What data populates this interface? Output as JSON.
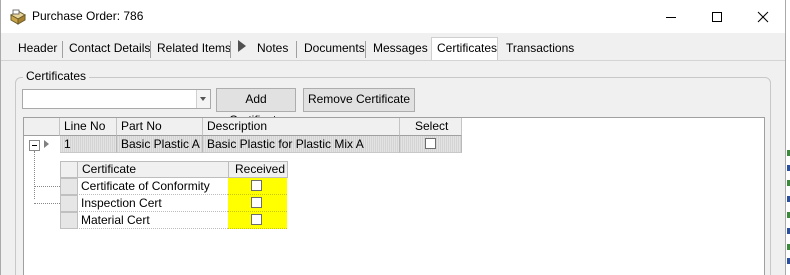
{
  "window": {
    "title": "Purchase Order: 786",
    "controls": {
      "minimize": "minimize",
      "maximize": "maximize",
      "close": "close"
    }
  },
  "tabs": [
    {
      "label": "Header"
    },
    {
      "label": "Contact Details"
    },
    {
      "label": "Related Items"
    },
    {
      "label": "Notes"
    },
    {
      "label": "Documents"
    },
    {
      "label": "Messages"
    },
    {
      "label": "Certificates",
      "active": true
    },
    {
      "label": "Transactions"
    }
  ],
  "certificates_group": {
    "legend": "Certificates",
    "combo_value": "",
    "add_button": "Add Certificate",
    "remove_button": "Remove Certificate"
  },
  "grid": {
    "columns": [
      "Line No",
      "Part No",
      "Description",
      "Select"
    ],
    "rows": [
      {
        "line_no": "1",
        "part_no": "Basic Plastic A",
        "description": "Basic Plastic for Plastic Mix A",
        "select": false
      }
    ],
    "child": {
      "columns": [
        "Certificate",
        "Received"
      ],
      "rows": [
        {
          "certificate": "Certificate of Conformity",
          "received": false
        },
        {
          "certificate": "Inspection Cert",
          "received": false
        },
        {
          "certificate": "Material Cert",
          "received": false
        }
      ]
    }
  },
  "colors": {
    "received_highlight": "#ffff00",
    "panel_bg": "#f0f0f0"
  }
}
